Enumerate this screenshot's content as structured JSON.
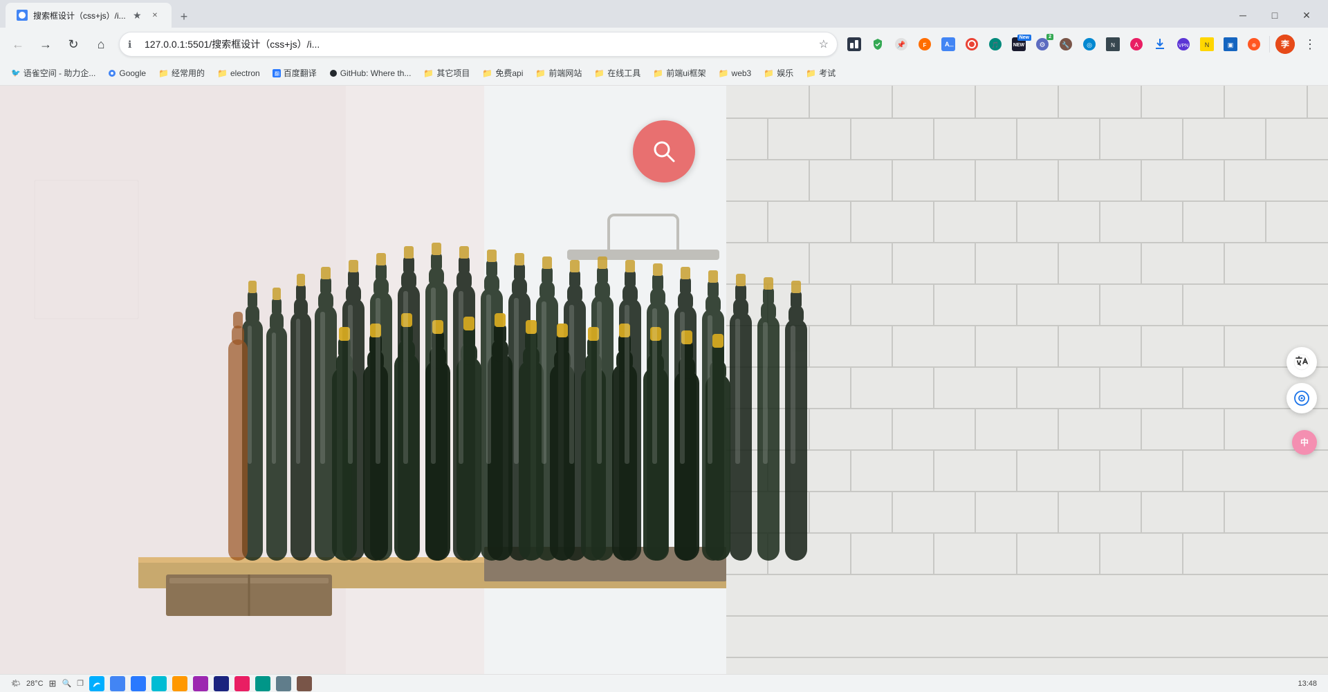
{
  "browser": {
    "tab": {
      "title": "搜索框设计（css+js）/i...",
      "url": "127.0.0.1:5501/搜索框设计（css+js）/i...",
      "favicon_color": "#4285f4"
    },
    "nav": {
      "back_tooltip": "后退",
      "forward_tooltip": "前进",
      "refresh_tooltip": "重新加载",
      "home_tooltip": "主页"
    },
    "address": {
      "full_url": "127.0.0.1:5501/搜索框设计（css+js）/i...",
      "security_label": "安全"
    },
    "bookmarks": [
      {
        "label": "语雀空间 - 助力企..."
      },
      {
        "label": "Google"
      },
      {
        "label": "经常用的"
      },
      {
        "label": "electron"
      },
      {
        "label": "百度翻译"
      },
      {
        "label": "GitHub: Where th..."
      },
      {
        "label": "其它项目"
      },
      {
        "label": "免费api"
      },
      {
        "label": "前端网站"
      },
      {
        "label": "在线工具"
      },
      {
        "label": "前端ui框架"
      },
      {
        "label": "web3"
      },
      {
        "label": "娱乐"
      },
      {
        "label": "考试"
      }
    ],
    "extensions": {
      "new_badge": "New",
      "counter": "2"
    }
  },
  "page": {
    "search_icon": "🔍",
    "background_desc": "beer bottles on shelf with white tile wall",
    "float_btn1_icon": "⇄",
    "float_btn2_icon": "◎",
    "float_btn3_icon": "中"
  },
  "statusbar": {
    "weather": "28°C",
    "weather_icon": "🌤",
    "time": "13:48",
    "taskbar_icons": [
      "⊞",
      "Ω",
      "◎",
      "⬡",
      "⬡",
      "⬡",
      "⬡",
      "⬡",
      "⬡",
      "⬡"
    ]
  }
}
